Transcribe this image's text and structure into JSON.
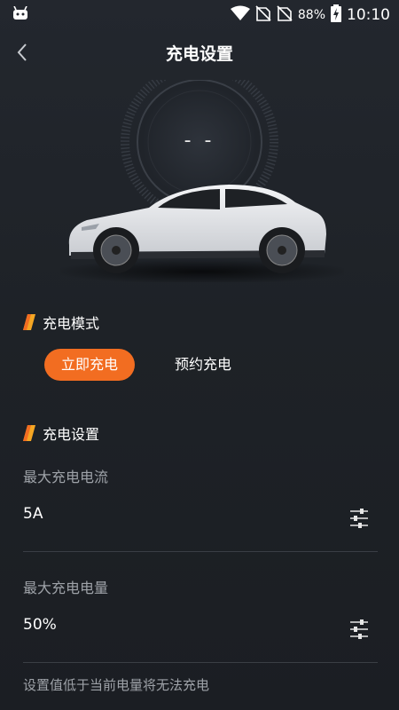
{
  "status_bar": {
    "battery": "88%",
    "time": "10:10",
    "icons": [
      "robot-icon",
      "wifi-icon",
      "no-sim-icon",
      "no-sim-icon",
      "battery-charging-icon"
    ]
  },
  "header": {
    "title": "充电设置",
    "back_icon": "chevron-left-icon"
  },
  "gauge": {
    "value": "- -"
  },
  "charge_mode": {
    "title": "充电模式",
    "tabs": [
      {
        "label": "立即充电",
        "active": true
      },
      {
        "label": "预约充电",
        "active": false
      }
    ]
  },
  "charge_settings": {
    "title": "充电设置",
    "max_current": {
      "label": "最大充电电流",
      "value": "5A"
    },
    "max_level": {
      "label": "最大充电电量",
      "value": "50%"
    },
    "hint": "设置值低于当前电量将无法充电"
  },
  "colors": {
    "accent": "#f26d21",
    "background": "#1e2227",
    "muted_text": "#9ea2a8"
  }
}
